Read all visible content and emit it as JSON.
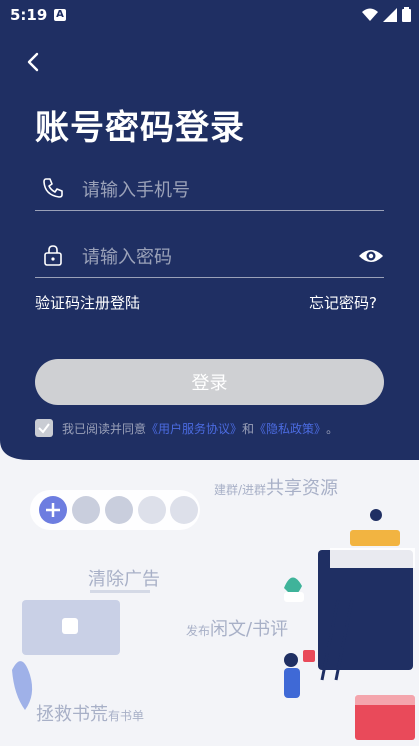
{
  "status": {
    "time": "5:19",
    "notif": "A"
  },
  "page": {
    "title": "账号密码登录"
  },
  "phone": {
    "placeholder": "请输入手机号"
  },
  "password": {
    "placeholder": "请输入密码"
  },
  "links": {
    "sms_login": "验证码注册登陆",
    "forgot": "忘记密码?"
  },
  "login_button": "登录",
  "agreement": {
    "prefix": "我已阅读并同意",
    "terms": "《用户服务协议》",
    "and": "和",
    "privacy": "《隐私政策》",
    "suffix": "。"
  },
  "features": {
    "share_small": "建群/进群",
    "share_big": "共享资源",
    "ads": "清除广告",
    "post_small": "发布",
    "post_big": "闲文/书评",
    "rescue_big": "拯救书荒",
    "rescue_small": "有书单"
  },
  "colors": {
    "bg": "#1f2f63",
    "link": "#4b6be0",
    "button": "#cfd0d3"
  }
}
